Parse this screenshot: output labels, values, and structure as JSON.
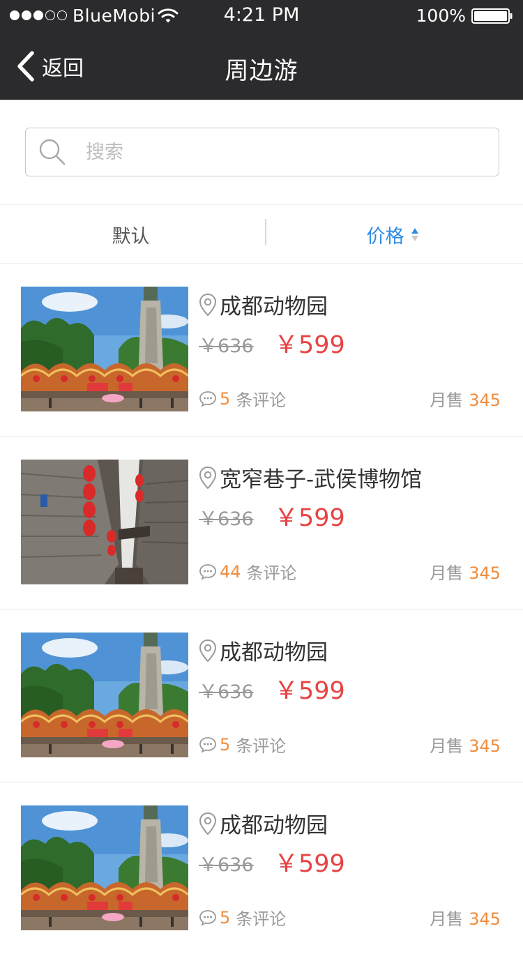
{
  "status_bar": {
    "carrier": "BlueMobi",
    "time": "4:21 PM",
    "battery": "100%",
    "signal_filled": 3,
    "signal_total": 5
  },
  "nav": {
    "back_label": "返回",
    "title": "周边游"
  },
  "search": {
    "placeholder": "搜索",
    "value": ""
  },
  "sort": {
    "default_label": "默认",
    "price_label": "价格",
    "active": "价格"
  },
  "colors": {
    "accent_blue": "#2f8ce6",
    "price_red": "#e84343",
    "highlight_orange": "#f08c3c",
    "nav_bg": "#2b2b2d"
  },
  "items": [
    {
      "name": "成都动物园",
      "original_price": "￥636",
      "price": "￥599",
      "comment_count": "5",
      "comment_label": "条评论",
      "sales_label": "月售",
      "sales_count": "345",
      "image": "zoo-gate-photo"
    },
    {
      "name": "宽窄巷子-武侯博物馆",
      "original_price": "￥636",
      "price": "￥599",
      "comment_count": "44",
      "comment_label": "条评论",
      "sales_label": "月售",
      "sales_count": "345",
      "image": "alley-lanterns-photo"
    },
    {
      "name": "成都动物园",
      "original_price": "￥636",
      "price": "￥599",
      "comment_count": "5",
      "comment_label": "条评论",
      "sales_label": "月售",
      "sales_count": "345",
      "image": "zoo-gate-photo"
    },
    {
      "name": "成都动物园",
      "original_price": "￥636",
      "price": "￥599",
      "comment_count": "5",
      "comment_label": "条评论",
      "sales_label": "月售",
      "sales_count": "345",
      "image": "zoo-gate-photo"
    }
  ]
}
